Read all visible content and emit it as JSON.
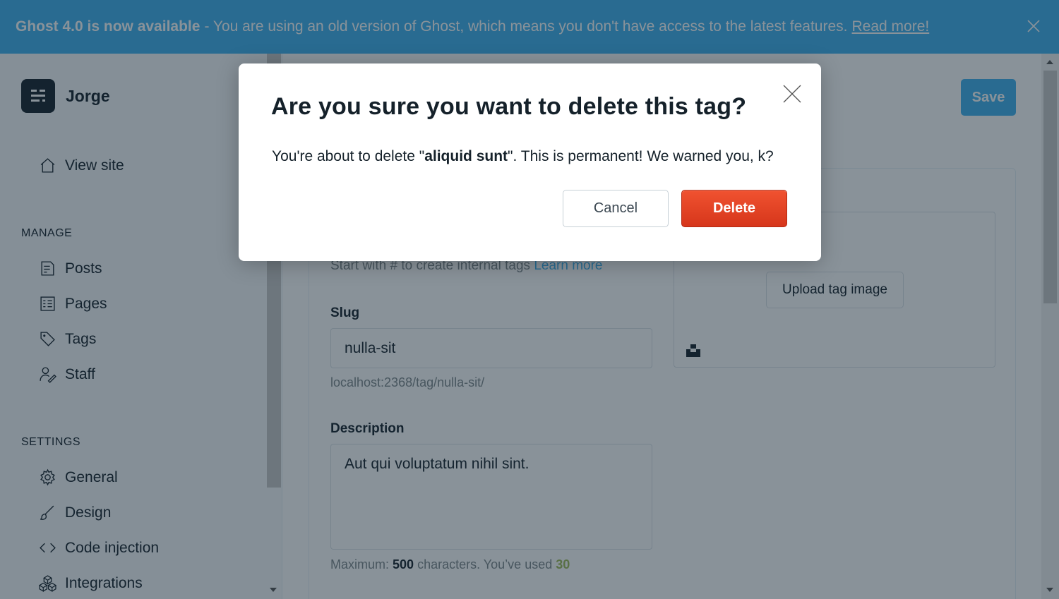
{
  "banner": {
    "headline": "Ghost 4.0 is now available",
    "message": "- You are using an old version of Ghost, which means you don't have access to the latest features.",
    "link": "Read more!",
    "close_icon": "close-icon"
  },
  "sidebar": {
    "brand": "Jorge",
    "view_site": "View site",
    "manage_label": "MANAGE",
    "manage_items": [
      {
        "label": "Posts",
        "icon": "posts-icon"
      },
      {
        "label": "Pages",
        "icon": "pages-icon"
      },
      {
        "label": "Tags",
        "icon": "tag-icon"
      },
      {
        "label": "Staff",
        "icon": "staff-icon"
      }
    ],
    "settings_label": "SETTINGS",
    "settings_items": [
      {
        "label": "General",
        "icon": "gear-icon"
      },
      {
        "label": "Design",
        "icon": "brush-icon"
      },
      {
        "label": "Code injection",
        "icon": "code-icon"
      },
      {
        "label": "Integrations",
        "icon": "integrations-icon"
      }
    ]
  },
  "main": {
    "save_label": "Save",
    "hint_text": "Start with # to create internal tags",
    "hint_link": "Learn more",
    "slug_label": "Slug",
    "slug_value": "nulla-sit",
    "slug_url": "localhost:2368/tag/nulla-sit/",
    "description_label": "Description",
    "description_value": "Aut qui voluptatum nihil sint.",
    "count_prefix": "Maximum:",
    "count_max": "500",
    "count_mid": "characters. You’ve used",
    "count_used": "30",
    "upload_label": "Upload tag image"
  },
  "modal": {
    "title": "Are you sure you want to delete this tag?",
    "body_prefix": "You're about to delete \"",
    "tag_name": "aliquid sunt",
    "body_suffix": "\". This is permanent! We warned you, k?",
    "cancel_label": "Cancel",
    "delete_label": "Delete"
  },
  "colors": {
    "accent": "#3eb0ef",
    "danger": "#e2401f",
    "text": "#15212a"
  }
}
